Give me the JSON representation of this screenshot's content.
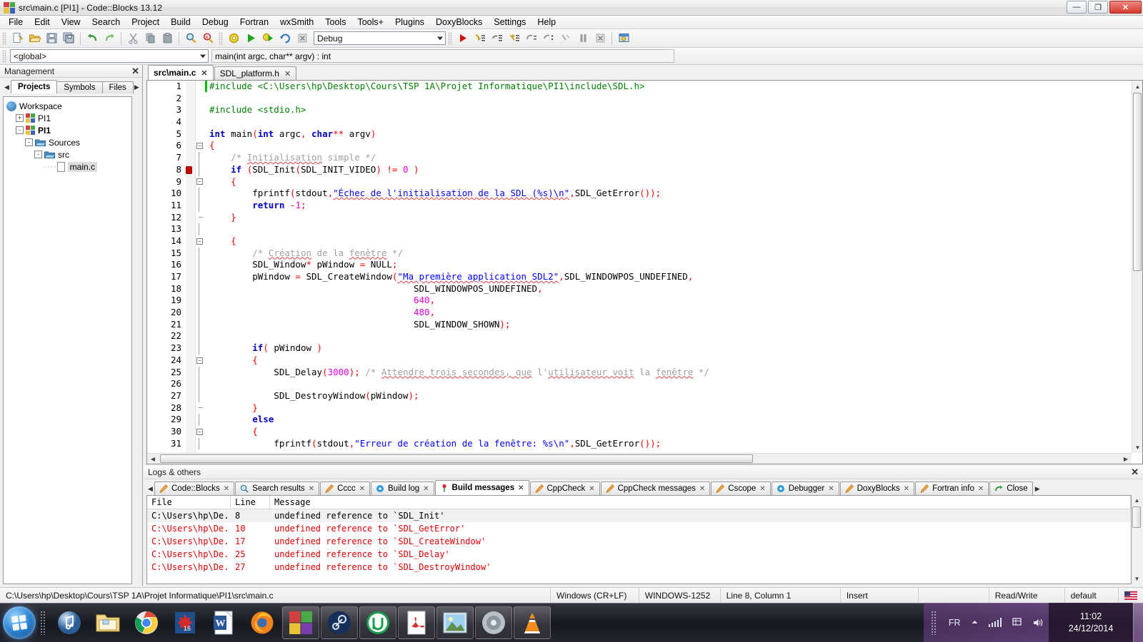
{
  "window": {
    "title": "src\\main.c [PI1] - Code::Blocks 13.12",
    "icon": "codeblocks-icon",
    "buttons": {
      "minimize": "—",
      "maximize": "❐",
      "close": "✕"
    }
  },
  "menubar": {
    "items": [
      "File",
      "Edit",
      "View",
      "Search",
      "Project",
      "Build",
      "Debug",
      "Fortran",
      "wxSmith",
      "Tools",
      "Tools+",
      "Plugins",
      "DoxyBlocks",
      "Settings",
      "Help"
    ]
  },
  "toolbar_main": {
    "icons": [
      "new-file-icon",
      "open-file-icon",
      "save-icon",
      "save-all-icon",
      "undo-icon",
      "redo-icon",
      "cut-icon",
      "copy-icon",
      "paste-icon",
      "find-icon",
      "replace-icon"
    ],
    "build_icons": [
      "build-icon",
      "run-icon",
      "build-and-run-icon",
      "rebuild-icon",
      "abort-icon"
    ],
    "target_combo": "Debug",
    "debug_icons": [
      "debug-continue-icon",
      "step-into-icon",
      "step-over-icon",
      "step-out-icon",
      "next-instruction-icon",
      "step-into-instruction-icon",
      "run-to-cursor-icon",
      "pause-icon",
      "stop-debugger-icon",
      "debugging-windows-icon"
    ]
  },
  "toolbar_scope": {
    "scope_combo": "<global>",
    "function_field": "main(int argc, char** argv) : int"
  },
  "management": {
    "title": "Management",
    "close_label": "✕",
    "tabs": [
      {
        "label": "Projects",
        "active": true
      },
      {
        "label": "Symbols",
        "active": false
      },
      {
        "label": "Files",
        "active": false
      }
    ],
    "prev_arrow": "◀",
    "next_arrow": "▶",
    "tree": [
      {
        "label": "Workspace",
        "icon": "workspace-icon",
        "depth": 0,
        "expander": "",
        "bold": false
      },
      {
        "label": "PI1",
        "icon": "project-icon",
        "depth": 1,
        "expander": "+",
        "bold": false
      },
      {
        "label": "PI1",
        "icon": "project-icon",
        "depth": 1,
        "expander": "-",
        "bold": true
      },
      {
        "label": "Sources",
        "icon": "folder-icon",
        "depth": 2,
        "expander": "-",
        "bold": false
      },
      {
        "label": "src",
        "icon": "folder-icon",
        "depth": 3,
        "expander": "-",
        "bold": false
      },
      {
        "label": "main.c",
        "icon": "file-icon",
        "depth": 4,
        "expander": "",
        "bold": false,
        "selected": true
      }
    ]
  },
  "editor": {
    "tabs": [
      {
        "label": "src\\main.c",
        "active": true,
        "close": "✕"
      },
      {
        "label": "SDL_platform.h",
        "active": false,
        "close": "✕"
      }
    ],
    "first_line": 1,
    "lines": [
      {
        "n": 1,
        "fold": "",
        "mark": "changed",
        "tokens": [
          {
            "t": "#include ",
            "c": "pre"
          },
          {
            "t": "<C:\\Users\\hp\\Desktop\\Cours\\TSP 1A\\Projet Informatique\\PI1\\include\\SDL.h>",
            "c": "pre"
          }
        ]
      },
      {
        "n": 2,
        "fold": "",
        "mark": "",
        "tokens": []
      },
      {
        "n": 3,
        "fold": "",
        "mark": "",
        "tokens": [
          {
            "t": "#include <stdio.h>",
            "c": "pre"
          }
        ]
      },
      {
        "n": 4,
        "fold": "",
        "mark": "",
        "tokens": []
      },
      {
        "n": 5,
        "fold": "",
        "mark": "",
        "tokens": [
          {
            "t": "int ",
            "c": "kw"
          },
          {
            "t": "main",
            "c": "plain"
          },
          {
            "t": "(",
            "c": "op"
          },
          {
            "t": "int ",
            "c": "kw"
          },
          {
            "t": "argc",
            "c": "plain"
          },
          {
            "t": ", ",
            "c": "op"
          },
          {
            "t": "char",
            "c": "kw"
          },
          {
            "t": "**",
            "c": "op"
          },
          {
            "t": " argv",
            "c": "plain"
          },
          {
            "t": ")",
            "c": "op"
          }
        ]
      },
      {
        "n": 6,
        "fold": "box-open",
        "mark": "",
        "tokens": [
          {
            "t": "{",
            "c": "op"
          }
        ]
      },
      {
        "n": 7,
        "fold": "line",
        "mark": "",
        "tokens": [
          {
            "t": "    /* ",
            "c": "cmt"
          },
          {
            "t": "Initialisation",
            "c": "cmt sq"
          },
          {
            "t": " simple */",
            "c": "cmt"
          }
        ]
      },
      {
        "n": 8,
        "fold": "line",
        "mark": "breakpoint",
        "tokens": [
          {
            "t": "    ",
            "c": "plain"
          },
          {
            "t": "if ",
            "c": "kw"
          },
          {
            "t": "(",
            "c": "op"
          },
          {
            "t": "SDL_Init",
            "c": "plain"
          },
          {
            "t": "(",
            "c": "op"
          },
          {
            "t": "SDL_INIT_VIDEO",
            "c": "plain"
          },
          {
            "t": ") ",
            "c": "op"
          },
          {
            "t": "!= ",
            "c": "op"
          },
          {
            "t": "0",
            "c": "num"
          },
          {
            "t": " )",
            "c": "op"
          }
        ]
      },
      {
        "n": 9,
        "fold": "box-open",
        "mark": "",
        "tokens": [
          {
            "t": "    ",
            "c": "plain"
          },
          {
            "t": "{",
            "c": "op"
          }
        ]
      },
      {
        "n": 10,
        "fold": "line",
        "mark": "",
        "tokens": [
          {
            "t": "        fprintf",
            "c": "plain"
          },
          {
            "t": "(",
            "c": "op"
          },
          {
            "t": "stdout",
            "c": "plain"
          },
          {
            "t": ",",
            "c": "op"
          },
          {
            "t": "\"Échec de l'initialisation de la SDL (%s)\\n\"",
            "c": "str sq"
          },
          {
            "t": ",",
            "c": "op"
          },
          {
            "t": "SDL_GetError",
            "c": "plain"
          },
          {
            "t": "())",
            "c": "op"
          },
          {
            "t": ";",
            "c": "op"
          }
        ]
      },
      {
        "n": 11,
        "fold": "line",
        "mark": "",
        "tokens": [
          {
            "t": "        ",
            "c": "plain"
          },
          {
            "t": "return ",
            "c": "kw"
          },
          {
            "t": "-",
            "c": "op"
          },
          {
            "t": "1",
            "c": "num"
          },
          {
            "t": ";",
            "c": "op"
          }
        ]
      },
      {
        "n": 12,
        "fold": "line-end",
        "mark": "",
        "tokens": [
          {
            "t": "    ",
            "c": "plain"
          },
          {
            "t": "}",
            "c": "op"
          }
        ]
      },
      {
        "n": 13,
        "fold": "line",
        "mark": "",
        "tokens": []
      },
      {
        "n": 14,
        "fold": "box-open",
        "mark": "",
        "tokens": [
          {
            "t": "    ",
            "c": "plain"
          },
          {
            "t": "{",
            "c": "op"
          }
        ]
      },
      {
        "n": 15,
        "fold": "line",
        "mark": "",
        "tokens": [
          {
            "t": "        /* ",
            "c": "cmt"
          },
          {
            "t": "Création",
            "c": "cmt sq"
          },
          {
            "t": " de la ",
            "c": "cmt"
          },
          {
            "t": "fenêtre",
            "c": "cmt sq"
          },
          {
            "t": " */",
            "c": "cmt"
          }
        ]
      },
      {
        "n": 16,
        "fold": "line",
        "mark": "",
        "tokens": [
          {
            "t": "        SDL_Window",
            "c": "plain"
          },
          {
            "t": "*",
            "c": "op"
          },
          {
            "t": " pWindow ",
            "c": "plain"
          },
          {
            "t": "=",
            "c": "op"
          },
          {
            "t": " NULL",
            "c": "plain"
          },
          {
            "t": ";",
            "c": "op"
          }
        ]
      },
      {
        "n": 17,
        "fold": "line",
        "mark": "",
        "tokens": [
          {
            "t": "        pWindow ",
            "c": "plain"
          },
          {
            "t": "=",
            "c": "op"
          },
          {
            "t": " SDL_CreateWindow",
            "c": "plain"
          },
          {
            "t": "(",
            "c": "op"
          },
          {
            "t": "\"Ma première application SDL2\"",
            "c": "str sq"
          },
          {
            "t": ",",
            "c": "op"
          },
          {
            "t": "SDL_WINDOWPOS_UNDEFINED",
            "c": "plain"
          },
          {
            "t": ",",
            "c": "op"
          }
        ]
      },
      {
        "n": 18,
        "fold": "line",
        "mark": "",
        "tokens": [
          {
            "t": "                                      SDL_WINDOWPOS_UNDEFINED",
            "c": "plain"
          },
          {
            "t": ",",
            "c": "op"
          }
        ]
      },
      {
        "n": 19,
        "fold": "line",
        "mark": "",
        "tokens": [
          {
            "t": "                                      ",
            "c": "plain"
          },
          {
            "t": "640",
            "c": "num"
          },
          {
            "t": ",",
            "c": "op"
          }
        ]
      },
      {
        "n": 20,
        "fold": "line",
        "mark": "",
        "tokens": [
          {
            "t": "                                      ",
            "c": "plain"
          },
          {
            "t": "480",
            "c": "num"
          },
          {
            "t": ",",
            "c": "op"
          }
        ]
      },
      {
        "n": 21,
        "fold": "line",
        "mark": "",
        "tokens": [
          {
            "t": "                                      SDL_WINDOW_SHOWN",
            "c": "plain"
          },
          {
            "t": ");",
            "c": "op"
          }
        ]
      },
      {
        "n": 22,
        "fold": "line",
        "mark": "",
        "tokens": []
      },
      {
        "n": 23,
        "fold": "line",
        "mark": "",
        "tokens": [
          {
            "t": "        ",
            "c": "plain"
          },
          {
            "t": "if",
            "c": "kw"
          },
          {
            "t": "(",
            "c": "op"
          },
          {
            "t": " pWindow ",
            "c": "plain"
          },
          {
            "t": ")",
            "c": "op"
          }
        ]
      },
      {
        "n": 24,
        "fold": "box-open",
        "mark": "",
        "tokens": [
          {
            "t": "        ",
            "c": "plain"
          },
          {
            "t": "{",
            "c": "op"
          }
        ]
      },
      {
        "n": 25,
        "fold": "line",
        "mark": "",
        "tokens": [
          {
            "t": "            SDL_Delay",
            "c": "plain"
          },
          {
            "t": "(",
            "c": "op"
          },
          {
            "t": "3000",
            "c": "num"
          },
          {
            "t": ")",
            "c": "op"
          },
          {
            "t": ";",
            "c": "op"
          },
          {
            "t": " /* ",
            "c": "cmt"
          },
          {
            "t": "Attendre trois secondes, que",
            "c": "cmt sq"
          },
          {
            "t": " l'",
            "c": "cmt"
          },
          {
            "t": "utilisateur voit",
            "c": "cmt sq"
          },
          {
            "t": " la ",
            "c": "cmt"
          },
          {
            "t": "fenêtre",
            "c": "cmt sq"
          },
          {
            "t": " */",
            "c": "cmt"
          }
        ]
      },
      {
        "n": 26,
        "fold": "line",
        "mark": "",
        "tokens": []
      },
      {
        "n": 27,
        "fold": "line",
        "mark": "",
        "tokens": [
          {
            "t": "            SDL_DestroyWindow",
            "c": "plain"
          },
          {
            "t": "(",
            "c": "op"
          },
          {
            "t": "pWindow",
            "c": "plain"
          },
          {
            "t": ")",
            "c": "op"
          },
          {
            "t": ";",
            "c": "op"
          }
        ]
      },
      {
        "n": 28,
        "fold": "line-end",
        "mark": "",
        "tokens": [
          {
            "t": "        ",
            "c": "plain"
          },
          {
            "t": "}",
            "c": "op"
          }
        ]
      },
      {
        "n": 29,
        "fold": "line",
        "mark": "",
        "tokens": [
          {
            "t": "        ",
            "c": "plain"
          },
          {
            "t": "else",
            "c": "kw"
          }
        ]
      },
      {
        "n": 30,
        "fold": "box-open",
        "mark": "",
        "tokens": [
          {
            "t": "        ",
            "c": "plain"
          },
          {
            "t": "{",
            "c": "op"
          }
        ]
      },
      {
        "n": 31,
        "fold": "line",
        "mark": "",
        "tokens": [
          {
            "t": "            fprintf",
            "c": "plain"
          },
          {
            "t": "(",
            "c": "op"
          },
          {
            "t": "stdout",
            "c": "plain"
          },
          {
            "t": ",",
            "c": "op"
          },
          {
            "t": "\"Erreur de création de la fenêtre: %s\\n\"",
            "c": "str"
          },
          {
            "t": ",",
            "c": "op"
          },
          {
            "t": "SDL_GetError",
            "c": "plain"
          },
          {
            "t": "());",
            "c": "op"
          }
        ]
      }
    ]
  },
  "logs": {
    "title": "Logs & others",
    "close_label": "✕",
    "prev_arrow": "◀",
    "next_arrow": "▶",
    "tabs": [
      {
        "label": "Code::Blocks",
        "icon": "pencil-icon",
        "active": false,
        "close": "✕"
      },
      {
        "label": "Search results",
        "icon": "magnifier-icon",
        "active": false,
        "close": "✕"
      },
      {
        "label": "Cccc",
        "icon": "pencil-icon",
        "active": false,
        "close": "✕"
      },
      {
        "label": "Build log",
        "icon": "gear-blue-icon",
        "active": false,
        "close": "✕"
      },
      {
        "label": "Build messages",
        "icon": "pin-icon",
        "active": true,
        "close": "✕"
      },
      {
        "label": "CppCheck",
        "icon": "pencil-icon",
        "active": false,
        "close": "✕"
      },
      {
        "label": "CppCheck messages",
        "icon": "pencil-icon",
        "active": false,
        "close": "✕"
      },
      {
        "label": "Cscope",
        "icon": "pencil-icon",
        "active": false,
        "close": "✕"
      },
      {
        "label": "Debugger",
        "icon": "gear-blue-icon",
        "active": false,
        "close": "✕"
      },
      {
        "label": "DoxyBlocks",
        "icon": "pencil-icon",
        "active": false,
        "close": "✕"
      },
      {
        "label": "Fortran info",
        "icon": "pencil-icon",
        "active": false,
        "close": "✕"
      },
      {
        "label": "Close",
        "icon": "close-green-icon",
        "active": false,
        "close": ""
      }
    ],
    "table": {
      "columns": [
        "File",
        "Line",
        "Message"
      ],
      "rows": [
        {
          "file": "C:\\Users\\hp\\De...",
          "line": "8",
          "message": "undefined reference to `SDL_Init'",
          "error": false
        },
        {
          "file": "C:\\Users\\hp\\De...",
          "line": "10",
          "message": "undefined reference to `SDL_GetError'",
          "error": true
        },
        {
          "file": "C:\\Users\\hp\\De...",
          "line": "17",
          "message": "undefined reference to `SDL_CreateWindow'",
          "error": true
        },
        {
          "file": "C:\\Users\\hp\\De...",
          "line": "25",
          "message": "undefined reference to `SDL_Delay'",
          "error": true
        },
        {
          "file": "C:\\Users\\hp\\De...",
          "line": "27",
          "message": "undefined reference to `SDL_DestroyWindow'",
          "error": true
        }
      ]
    }
  },
  "statusbar": {
    "path": "C:\\Users\\hp\\Desktop\\Cours\\TSP 1A\\Projet Informatique\\PI1\\src\\main.c",
    "eol": "Windows (CR+LF)",
    "encoding": "WINDOWS-1252",
    "caret": "Line 8, Column 1",
    "mode": "Insert",
    "blank": "",
    "access": "Read/Write",
    "profile": "default",
    "flag_icon": "us-flag-icon"
  },
  "taskbar": {
    "start_label": "start-orb",
    "items": [
      {
        "name": "itunes-icon",
        "open": false
      },
      {
        "name": "explorer-icon",
        "open": false
      },
      {
        "name": "chrome-icon",
        "open": false
      },
      {
        "name": "maple-icon",
        "open": false
      },
      {
        "name": "word-icon",
        "open": false
      },
      {
        "name": "firefox-icon",
        "open": false
      },
      {
        "name": "codeblocks-icon",
        "open": true
      },
      {
        "name": "steam-icon",
        "open": true
      },
      {
        "name": "utorrent-icon",
        "open": true
      },
      {
        "name": "acrobat-icon",
        "open": true
      },
      {
        "name": "photo-viewer-icon",
        "open": true
      },
      {
        "name": "audio-icon",
        "open": true
      },
      {
        "name": "vlc-icon",
        "open": true
      }
    ],
    "tray": {
      "language": "FR",
      "show_hidden_icon": "chevron-up-icon",
      "network_icon": "network-bars-icon",
      "action_center_icon": "flag-icon",
      "volume_icon": "speaker-icon",
      "time": "11:02",
      "date": "24/12/2014"
    }
  },
  "colors": {
    "keyword": "#0000c0",
    "preprocessor": "#008000",
    "string": "#0000ff",
    "number": "#e000e0",
    "comment": "#a0a0a0",
    "operator": "#ff0000",
    "error": "#dd0000"
  }
}
